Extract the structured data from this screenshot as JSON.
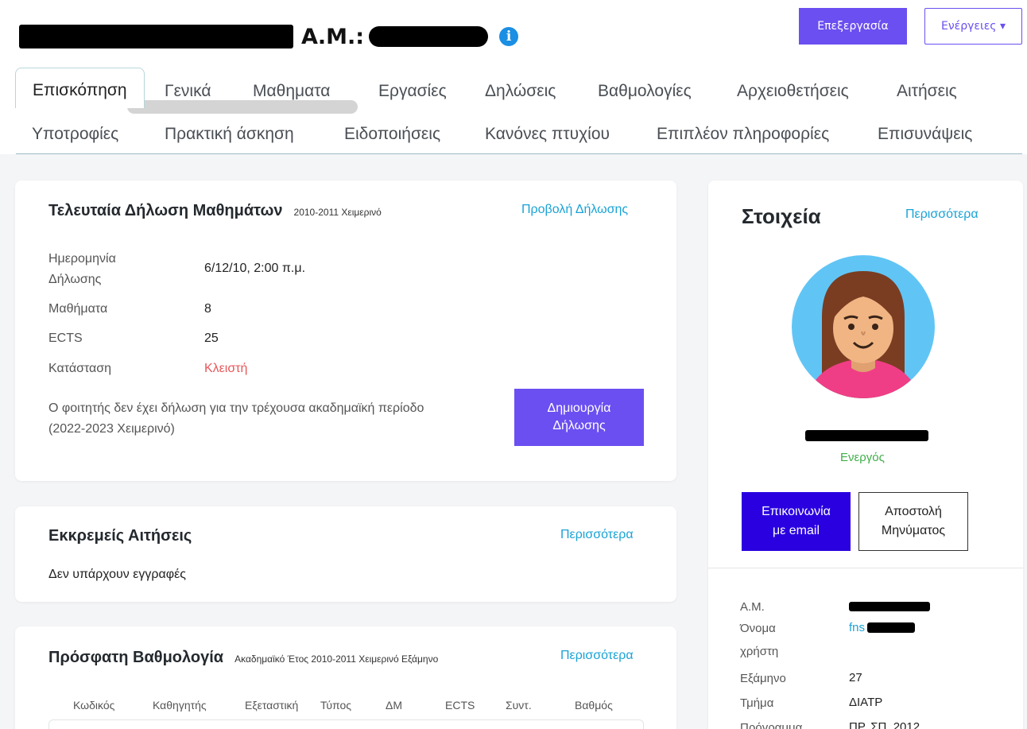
{
  "header": {
    "am_label": "Α.Μ.:",
    "info_icon": "info-icon",
    "edit_button": "Επεξεργασία",
    "actions_button": "Ενέργειες ▾"
  },
  "tabs": {
    "row1": [
      "Επισκόπηση",
      "Γενικά",
      "Μαθηματα",
      "Εργασίες",
      "Δηλώσεις",
      "Βαθμολογίες",
      "Αρχειοθετήσεις",
      "Αιτήσεις"
    ],
    "row2": [
      "Υποτροφίες",
      "Πρακτική άσκηση",
      "Ειδοποιήσεις",
      "Κανόνες πτυχίου",
      "Επιπλέον πληροφορίες",
      "Επισυνάψεις"
    ]
  },
  "last_registration": {
    "title": "Τελευταία Δήλωση Μαθημάτων",
    "period": "2010-2011 Χειμερινό",
    "view_link": "Προβολή Δήλωσης",
    "date_label_1": "Ημερομηνία",
    "date_label_2": "Δήλωσης",
    "date_value": "6/12/10, 2:00 π.μ.",
    "courses_label": "Μαθήματα",
    "courses_value": "8",
    "ects_label": "ECTS",
    "ects_value": "25",
    "status_label": "Κατάσταση",
    "status_value": "Κλειστή",
    "status_color": "#e8575a",
    "note_line1": "Ο φοιτητής δεν έχει δήλωση για την τρέχουσα ακαδημαϊκή περίοδο",
    "note_line2": "(2022-2023 Χειμερινό)",
    "create_line1": "Δημιουργία",
    "create_line2": "Δήλωσης"
  },
  "pending_requests": {
    "title": "Εκκρεμείς Αιτήσεις",
    "more_link": "Περισσότερα",
    "empty_text": "Δεν υπάρχουν εγγραφές"
  },
  "recent_grades": {
    "title": "Πρόσφατη Βαθμολογία",
    "subtitle": "Ακαδημαϊκό Έτος 2010-2011 Χειμερινό Εξάμηνο",
    "more_link": "Περισσότερα",
    "columns": [
      "Κωδικός",
      "Καθηγητής",
      "Εξεταστική",
      "Τύπος",
      "ΔΜ",
      "ECTS",
      "Συντ.",
      "Βαθμός"
    ]
  },
  "profile": {
    "title": "Στοιχεία",
    "more_link": "Περισσότερα",
    "status": "Ενεργός",
    "status_color": "#3fae49",
    "email_line1": "Επικοινωνία",
    "email_line2": "με email",
    "message_line1": "Αποστολή",
    "message_line2": "Μηνύματος",
    "am_label": "Α.Μ.",
    "username_label_1": "Όνομα",
    "username_label_2": "χρήστη",
    "username_value_prefix": "fns",
    "semester_label": "Εξάμηνο",
    "semester_value": "27",
    "department_label": "Τμήμα",
    "department_value": "ΔΙΑΤΡ",
    "program_label": "Πρόγραμμα",
    "program_value": "ΠΡ. ΣΠ. 2012"
  },
  "colors": {
    "accent": "#6b4ff1",
    "link": "#1aa3d6",
    "email_button": "#2a00e0"
  }
}
